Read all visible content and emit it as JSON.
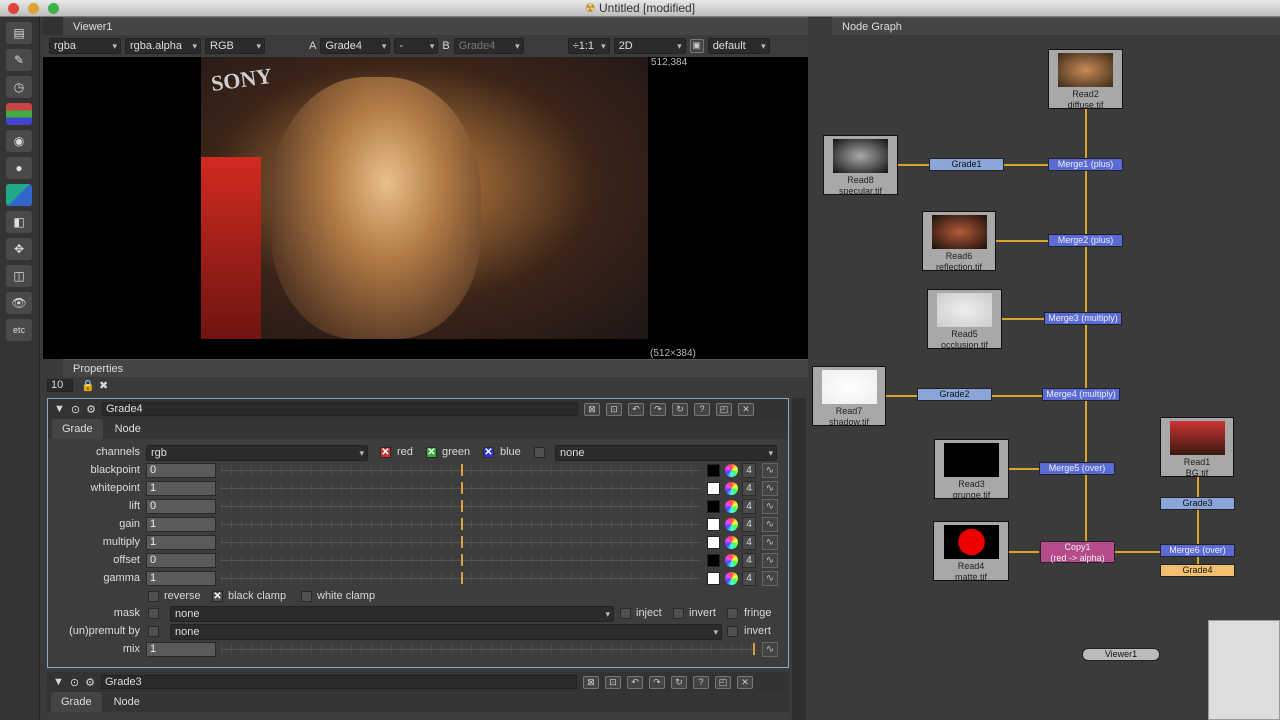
{
  "window": {
    "title": "Untitled [modified]"
  },
  "toolbar": {
    "tools": [
      "layout-icon",
      "paint-icon",
      "time-icon",
      "channel-icon",
      "color-icon",
      "filter-icon",
      "keyer-icon",
      "merge-icon",
      "transform-icon",
      "3d-icon",
      "views-icon",
      "other-icon"
    ],
    "etc_label": "etc"
  },
  "viewer": {
    "tab": "Viewer1",
    "channels": "rgba",
    "alpha": "rgba.alpha",
    "display": "RGB",
    "a_label": "A",
    "a_input": "Grade4",
    "op": "-",
    "b_label": "B",
    "b_input": "Grade4",
    "zoom": "÷1:1",
    "mode": "2D",
    "lut": "default",
    "coord_top": "512,384",
    "coord_bottom": "(512×384)",
    "image_caption": "SONY"
  },
  "properties": {
    "tab": "Properties",
    "max_panels": "10",
    "grade4": {
      "name": "Grade4",
      "tabs": [
        "Grade",
        "Node"
      ],
      "channels_label": "channels",
      "channels_value": "rgb",
      "red": "red",
      "green": "green",
      "blue": "blue",
      "extra_channel": "none",
      "params": [
        {
          "label": "blackpoint",
          "value": "0"
        },
        {
          "label": "whitepoint",
          "value": "1"
        },
        {
          "label": "lift",
          "value": "0"
        },
        {
          "label": "gain",
          "value": "1"
        },
        {
          "label": "multiply",
          "value": "1"
        },
        {
          "label": "offset",
          "value": "0"
        },
        {
          "label": "gamma",
          "value": "1"
        }
      ],
      "reverse": "reverse",
      "black_clamp": "black clamp",
      "white_clamp": "white clamp",
      "mask_label": "mask",
      "mask_value": "none",
      "inject": "inject",
      "invert": "invert",
      "fringe": "fringe",
      "premult_label": "(un)premult by",
      "premult_value": "none",
      "invert2": "invert",
      "mix_label": "mix",
      "mix_value": "1",
      "four": "4"
    },
    "grade3": {
      "name": "Grade3",
      "tabs": [
        "Grade",
        "Node"
      ]
    }
  },
  "nodegraph": {
    "tab": "Node Graph",
    "reads": [
      {
        "name": "Read2",
        "file": "diffuse.tif"
      },
      {
        "name": "Read8",
        "file": "specular.tif"
      },
      {
        "name": "Read6",
        "file": "reflection.tif"
      },
      {
        "name": "Read5",
        "file": "occlusion.tif"
      },
      {
        "name": "Read7",
        "file": "shadow.tif"
      },
      {
        "name": "Read3",
        "file": "grunge.tif"
      },
      {
        "name": "Read4",
        "file": "matte.tif"
      },
      {
        "name": "Read1",
        "file": "BG.tif"
      }
    ],
    "ops": {
      "grade1": "Grade1",
      "merge1": "Merge1 (plus)",
      "merge2": "Merge2 (plus)",
      "merge3": "Merge3 (multiply)",
      "grade2": "Grade2",
      "merge4": "Merge4 (multiply)",
      "merge5": "Merge5 (over)",
      "grade3": "Grade3",
      "copy1": "Copy1",
      "copy1_sub": "(red -> alpha)",
      "merge6": "Merge6 (over)",
      "grade4": "Grade4",
      "viewer1": "Viewer1"
    }
  }
}
